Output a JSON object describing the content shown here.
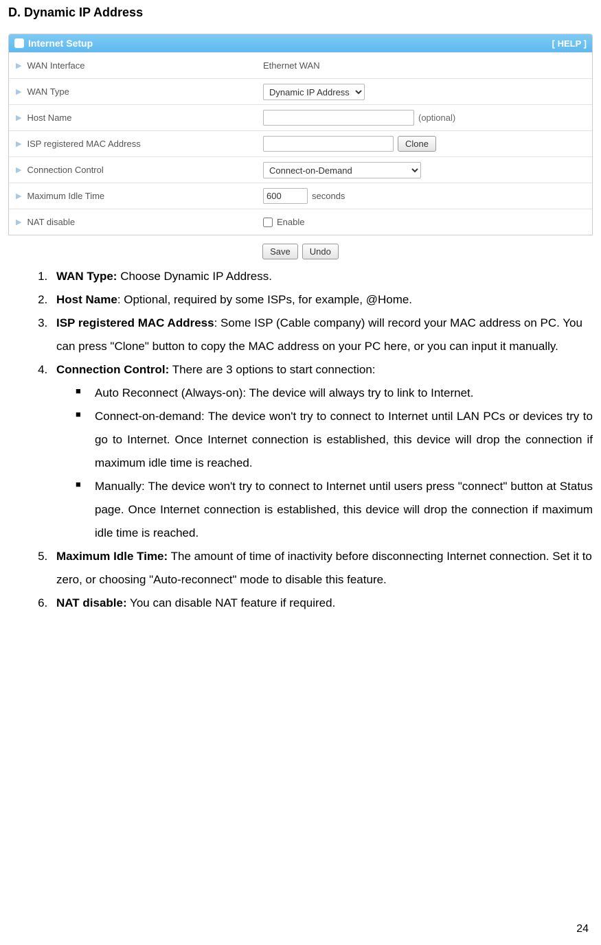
{
  "heading": "D. Dynamic IP Address",
  "panel": {
    "title": "Internet Setup",
    "help": "[ HELP ]",
    "rows": {
      "wan_interface": {
        "label": "WAN Interface",
        "value": "Ethernet WAN"
      },
      "wan_type": {
        "label": "WAN Type",
        "selected": "Dynamic IP Address"
      },
      "host_name": {
        "label": "Host Name",
        "value": "",
        "hint": "(optional)"
      },
      "isp_mac": {
        "label": "ISP registered MAC Address",
        "value": "",
        "button": "Clone"
      },
      "connection_control": {
        "label": "Connection Control",
        "selected": "Connect-on-Demand"
      },
      "max_idle": {
        "label": "Maximum Idle Time",
        "value": "600",
        "unit": "seconds"
      },
      "nat_disable": {
        "label": "NAT disable",
        "checkbox_label": "Enable"
      }
    },
    "buttons": {
      "save": "Save",
      "undo": "Undo"
    }
  },
  "instructions": {
    "items": [
      {
        "bold": "WAN Type:",
        "rest": " Choose Dynamic IP Address."
      },
      {
        "bold": "Host Name",
        "rest": ": Optional, required by some ISPs, for example, @Home."
      },
      {
        "bold": "ISP registered MAC Address",
        "rest": ": Some ISP (Cable company) will record your MAC address on PC. You can press \"Clone\" button to copy the MAC address on your PC here, or you can input it manually."
      },
      {
        "bold": "Connection Control:",
        "rest": " There are 3 options to start connection:",
        "sub": [
          "Auto Reconnect (Always-on): The device will always try to link to Internet.",
          "Connect-on-demand: The device won't try to connect to Internet until LAN PCs or devices try to go to Internet. Once Internet connection is established, this device will drop the connection if maximum idle time is reached.",
          "Manually: The device won't try to connect to Internet until users press \"connect\" button at Status page. Once Internet connection is established, this device will drop the connection if maximum idle time is reached."
        ]
      },
      {
        "bold": "Maximum Idle Time:",
        "rest": " The amount of time of inactivity before disconnecting Internet connection. Set it to zero, or choosing \"Auto-reconnect\" mode to disable this feature."
      },
      {
        "bold": "NAT disable:",
        "rest": " You can disable NAT feature if required."
      }
    ]
  },
  "page_number": "24"
}
